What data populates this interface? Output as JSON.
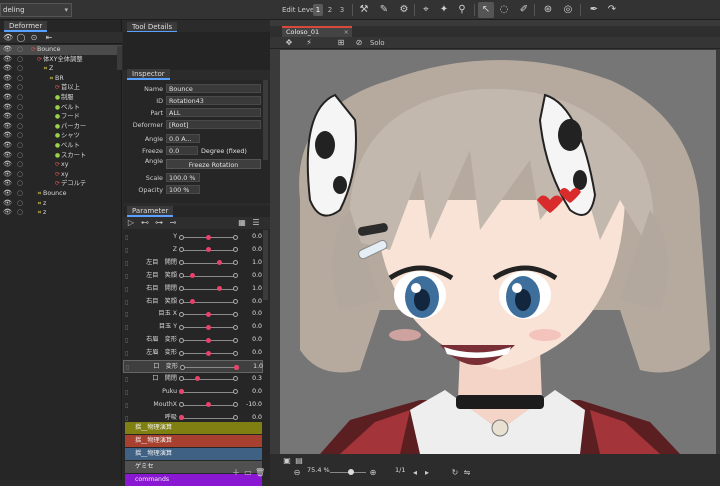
{
  "topbar": {
    "mode_label": "deling",
    "edit_level_label": "Edit Level:",
    "edit_levels": [
      "1",
      "2",
      "3"
    ]
  },
  "deformer": {
    "tab_label": "Deformer",
    "rows": [
      {
        "label": "Bounce",
        "type": "rot",
        "indent": 0,
        "selected": true
      },
      {
        "label": "体XY全体調整",
        "type": "rot",
        "indent": 1
      },
      {
        "label": "Z",
        "type": "warp",
        "indent": 2
      },
      {
        "label": "BR",
        "type": "warp",
        "indent": 3
      },
      {
        "label": "首以上",
        "type": "rot",
        "indent": 4
      },
      {
        "label": "制服",
        "type": "art",
        "indent": 4
      },
      {
        "label": "ベルト",
        "type": "art",
        "indent": 4
      },
      {
        "label": "フード",
        "type": "art",
        "indent": 4
      },
      {
        "label": "パーカー",
        "type": "art",
        "indent": 4
      },
      {
        "label": "シャツ",
        "type": "art",
        "indent": 4
      },
      {
        "label": "ベルト",
        "type": "art",
        "indent": 4
      },
      {
        "label": "スカート",
        "type": "art",
        "indent": 4
      },
      {
        "label": "xy",
        "type": "rot",
        "indent": 4
      },
      {
        "label": "xy",
        "type": "rot",
        "indent": 4
      },
      {
        "label": "デコルテ",
        "type": "rot",
        "indent": 4
      },
      {
        "label": "Bounce",
        "type": "warp",
        "indent": 1
      },
      {
        "label": "z",
        "type": "warp",
        "indent": 1
      },
      {
        "label": "z",
        "type": "warp",
        "indent": 1
      }
    ]
  },
  "tool_details": {
    "tab_label": "Tool Details"
  },
  "inspector": {
    "tab_label": "Inspector",
    "name_label": "Name",
    "name_value": "Bounce",
    "id_label": "ID",
    "id_value": "Rotation43",
    "part_label": "Part",
    "part_value": "ALL",
    "deformer_label": "Deformer",
    "deformer_value": "[Root]",
    "angle_label": "Angle",
    "angle_value": "0.0 A...",
    "freeze_angle_label": "Freeze Angle",
    "freeze_angle_value": "0.0",
    "freeze_angle_unit": "Degree (fixed)",
    "freeze_rotation_button": "Freeze Rotation",
    "scale_label": "Scale",
    "scale_value": "100.0 %",
    "opacity_label": "Opacity",
    "opacity_value": "100 %"
  },
  "parameter": {
    "tab_label": "Parameter",
    "rows": [
      {
        "label": "Y",
        "value": "0.0",
        "knob": 0.5
      },
      {
        "label": "Z",
        "value": "0.0",
        "knob": 0.5
      },
      {
        "label": "左目　開閉",
        "value": "1.0",
        "knob": 0.7
      },
      {
        "label": "左目　笑顔",
        "value": "0.0",
        "knob": 0.2
      },
      {
        "label": "右目　開閉",
        "value": "1.0",
        "knob": 0.7
      },
      {
        "label": "右目　笑顔",
        "value": "0.0",
        "knob": 0.2
      },
      {
        "label": "目玉 X",
        "value": "0.0",
        "knob": 0.5
      },
      {
        "label": "目玉 Y",
        "value": "0.0",
        "knob": 0.5
      },
      {
        "label": "右眉　変形",
        "value": "0.0",
        "knob": 0.5
      },
      {
        "label": "左眉　変形",
        "value": "0.0",
        "knob": 0.5
      },
      {
        "label": "口　変形",
        "value": "1.0",
        "knob": 1.0,
        "selected": true
      },
      {
        "label": "口　開閉",
        "value": "0.3",
        "knob": 0.3
      },
      {
        "label": "Puku",
        "value": "0.0",
        "knob": 0.0
      },
      {
        "label": "MouthX",
        "value": "-10.0",
        "knob": 0.5
      },
      {
        "label": "呼吸",
        "value": "0.0",
        "knob": 0.0
      }
    ],
    "groups": [
      {
        "label": "揺__物理演算",
        "color": "#7f7f12"
      },
      {
        "label": "揺__物理演算",
        "color": "#a8402f"
      },
      {
        "label": "揺__物理演算",
        "color": "#3f6184"
      },
      {
        "label": "ゲミセ",
        "color": "#505050"
      },
      {
        "label": "commands",
        "color": "#8a17d1"
      }
    ]
  },
  "canvas": {
    "tab_label": "Coloso_01",
    "solo_label": "Solo",
    "zoom_value": "75.4 %",
    "page_value": "1/1"
  }
}
